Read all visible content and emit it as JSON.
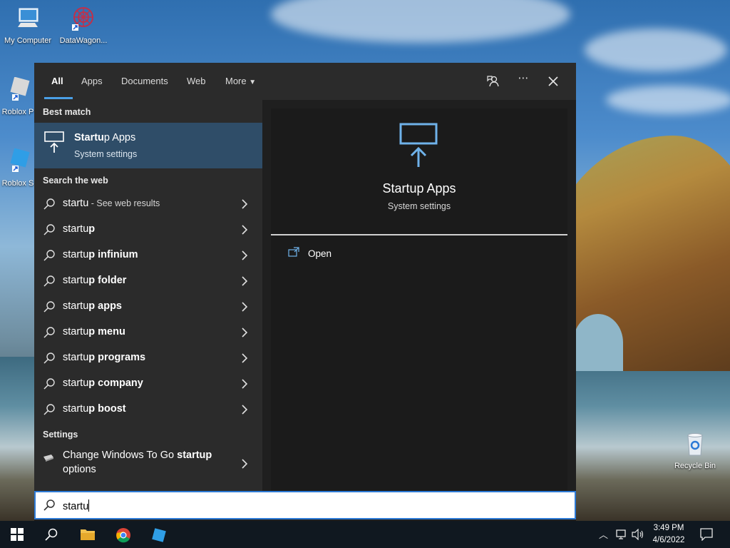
{
  "desktop": {
    "icons": [
      {
        "label": "My Computer"
      },
      {
        "label": "DataWagon..."
      },
      {
        "label": "Roblox P"
      },
      {
        "label": "Roblox S"
      },
      {
        "label": "Recycle Bin"
      }
    ]
  },
  "search_panel": {
    "tabs": [
      "All",
      "Apps",
      "Documents",
      "Web",
      "More"
    ],
    "active_tab": "All",
    "sections": {
      "best_match": "Best match",
      "search_web": "Search the web",
      "settings": "Settings"
    },
    "best_match": {
      "title_bold": "Startu",
      "title_rest": "p Apps",
      "subtitle": "System settings"
    },
    "web_results": [
      {
        "prefix": "startu",
        "suffix": "",
        "note": " - See web results"
      },
      {
        "prefix": "startu",
        "suffix": "p",
        "note": ""
      },
      {
        "prefix": "startu",
        "suffix": "p infinium",
        "note": ""
      },
      {
        "prefix": "startu",
        "suffix": "p folder",
        "note": ""
      },
      {
        "prefix": "startu",
        "suffix": "p apps",
        "note": ""
      },
      {
        "prefix": "startu",
        "suffix": "p menu",
        "note": ""
      },
      {
        "prefix": "startu",
        "suffix": "p programs",
        "note": ""
      },
      {
        "prefix": "startu",
        "suffix": "p company",
        "note": ""
      },
      {
        "prefix": "startu",
        "suffix": "p boost",
        "note": ""
      }
    ],
    "settings_result": {
      "line1_plain": "Change Windows To Go ",
      "line1_bold": "startup",
      "line2": "options"
    },
    "preview": {
      "title": "Startup Apps",
      "subtitle": "System settings",
      "action": "Open"
    },
    "search_box": {
      "value": "startu"
    }
  },
  "taskbar": {
    "time": "3:49 PM",
    "date": "4/6/2022"
  },
  "colors": {
    "accent": "#4a9fe6",
    "selected_row": "#2f4d68",
    "panel_bg": "#2b2b2b"
  }
}
